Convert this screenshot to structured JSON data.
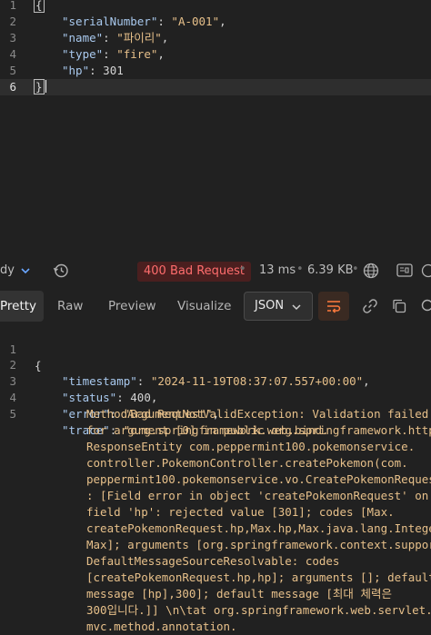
{
  "request_body": {
    "line_numbers": [
      "1",
      "2",
      "3",
      "4",
      "5",
      "6"
    ],
    "open_brace": "{",
    "close_brace": "}",
    "fields": [
      {
        "key": "\"serialNumber\"",
        "value": "\"A-001\"",
        "suffix": ","
      },
      {
        "key": "\"name\"",
        "value": "\"파이리\"",
        "suffix": ","
      },
      {
        "key": "\"type\"",
        "value": "\"fire\"",
        "suffix": ","
      },
      {
        "key": "\"hp\"",
        "value": "301",
        "suffix": ""
      }
    ]
  },
  "status_bar": {
    "body_selector": "dy",
    "status": "400 Bad Request",
    "time": "13 ms",
    "size": "6.39 KB"
  },
  "response_toolbar": {
    "tabs": [
      "Pretty",
      "Raw",
      "Preview",
      "Visualize"
    ],
    "format": "JSON"
  },
  "response_body": {
    "line_numbers": [
      "1",
      "2",
      "3",
      "4",
      "5"
    ],
    "open_brace": "{",
    "timestamp_key": "\"timestamp\"",
    "timestamp_value": "\"2024-11-19T08:37:07.557+00:00\"",
    "status_key": "\"status\"",
    "status_value": "400",
    "error_key": "\"error\"",
    "error_value": "\"Bad Request\"",
    "trace_key": "\"trace\"",
    "trace_lines": [
      "\"org.springframework.web.bind.",
      "MethodArgumentNotValidException: Validation failed",
      "for argument [0] in public org.springframework.http.",
      "ResponseEntity com.peppermint100.pokemonservice.",
      "controller.PokemonController.createPokemon(com.",
      "peppermint100.pokemonservice.vo.CreatePokemonRequest)",
      ": [Field error in object 'createPokemonRequest' on",
      "field 'hp': rejected value [301]; codes [Max.",
      "createPokemonRequest.hp,Max.hp,Max.java.lang.Integer,",
      "Max]; arguments [org.springframework.context.support.",
      "DefaultMessageSourceResolvable: codes",
      "[createPokemonRequest.hp,hp]; arguments []; default",
      "message [hp],300]; default message [최대 체력은",
      "300입니다.]] \\n\\tat org.springframework.web.servlet.",
      "mvc.method.annotation."
    ]
  }
}
